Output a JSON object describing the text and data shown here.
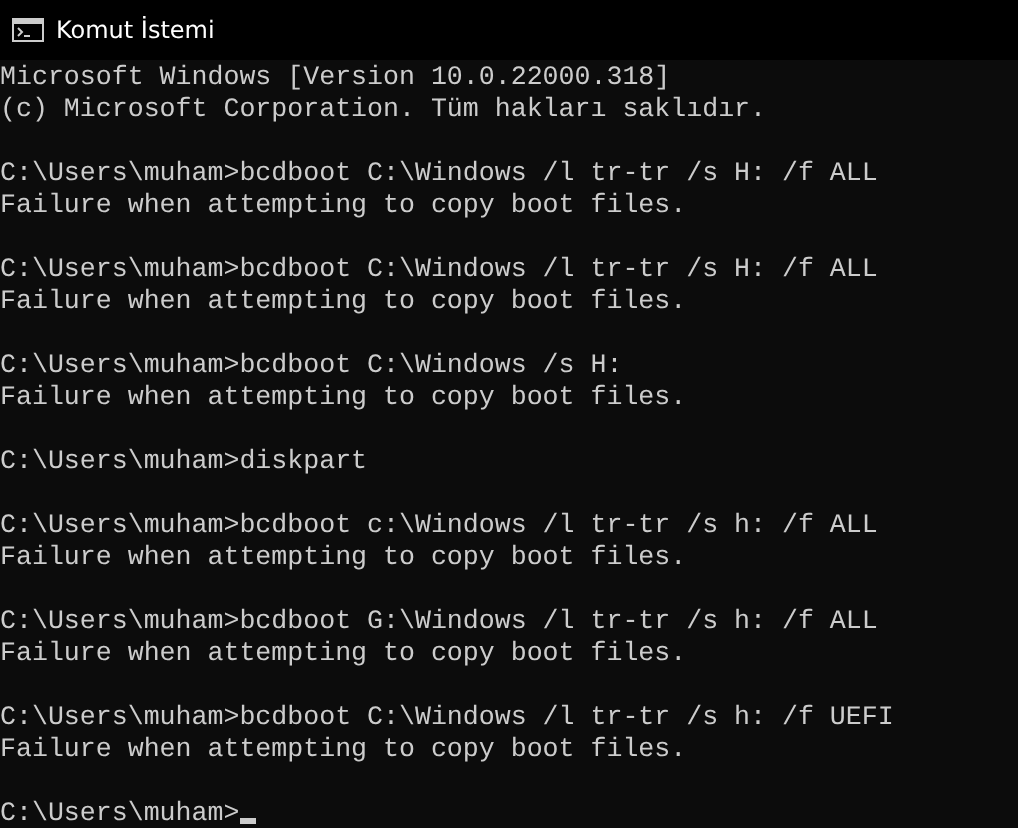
{
  "window": {
    "title": "Komut İstemi"
  },
  "console": {
    "blocks": [
      [
        "Microsoft Windows [Version 10.0.22000.318]",
        "(c) Microsoft Corporation. Tüm hakları saklıdır."
      ],
      [
        "C:\\Users\\muham>bcdboot C:\\Windows /l tr-tr /s H: /f ALL",
        "Failure when attempting to copy boot files."
      ],
      [
        "C:\\Users\\muham>bcdboot C:\\Windows /l tr-tr /s H: /f ALL",
        "Failure when attempting to copy boot files."
      ],
      [
        "C:\\Users\\muham>bcdboot C:\\Windows /s H:",
        "Failure when attempting to copy boot files."
      ],
      [
        "C:\\Users\\muham>diskpart"
      ],
      [
        "C:\\Users\\muham>bcdboot c:\\Windows /l tr-tr /s h: /f ALL",
        "Failure when attempting to copy boot files."
      ],
      [
        "C:\\Users\\muham>bcdboot G:\\Windows /l tr-tr /s h: /f ALL",
        "Failure when attempting to copy boot files."
      ],
      [
        "C:\\Users\\muham>bcdboot C:\\Windows /l tr-tr /s h: /f UEFI",
        "Failure when attempting to copy boot files."
      ]
    ],
    "prompt": "C:\\Users\\muham>"
  }
}
